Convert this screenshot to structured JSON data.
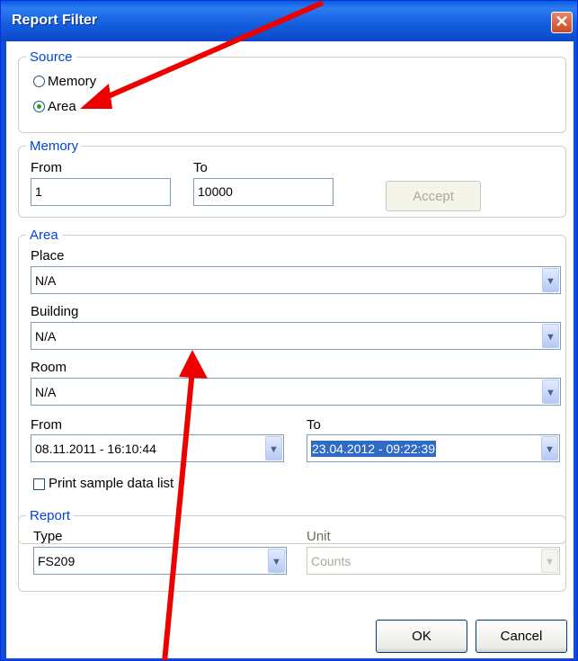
{
  "window": {
    "title": "Report Filter",
    "close_glyph": "✕"
  },
  "source": {
    "legend": "Source",
    "options": [
      {
        "label": "Memory",
        "selected": false
      },
      {
        "label": "Area",
        "selected": true
      }
    ]
  },
  "memory": {
    "legend": "Memory",
    "from_label": "From",
    "from_value": "1",
    "to_label": "To",
    "to_value": "10000",
    "accept_label": "Accept"
  },
  "area": {
    "legend": "Area",
    "place_label": "Place",
    "place_value": "N/A",
    "building_label": "Building",
    "building_value": "N/A",
    "room_label": "Room",
    "room_value": "N/A",
    "from_label": "From",
    "from_value": "08.11.2011 - 16:10:44",
    "to_label": "To",
    "to_value": "23.04.2012 - 09:22:39",
    "print_label": "Print sample data list",
    "print_checked": false
  },
  "report": {
    "legend": "Report",
    "type_label": "Type",
    "type_value": "FS209",
    "unit_label": "Unit",
    "unit_value": "Counts"
  },
  "buttons": {
    "ok": "OK",
    "cancel": "Cancel"
  },
  "annotation_color": "#ee0000",
  "dropdown_glyph": "▼"
}
